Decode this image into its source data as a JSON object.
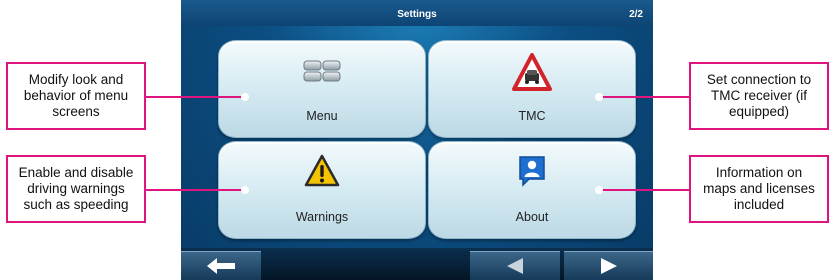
{
  "screen": {
    "title": "Settings",
    "page_indicator": "2/2"
  },
  "tiles": [
    {
      "label": "Menu",
      "icon": "menu-grid-icon"
    },
    {
      "label": "TMC",
      "icon": "tmc-traffic-warning-icon"
    },
    {
      "label": "Warnings",
      "icon": "warning-triangle-icon"
    },
    {
      "label": "About",
      "icon": "about-person-icon"
    }
  ],
  "callouts": {
    "menu": "Modify look and\nbehavior of menu\nscreens",
    "warnings": "Enable and disable\ndriving warnings\nsuch as speeding",
    "tmc": "Set connection to\nTMC receiver (if\nequipped)",
    "about": "Information on\nmaps and licenses\nincluded"
  },
  "nav": {
    "back_icon": "back-arrow-icon",
    "prev_icon": "previous-page-icon",
    "next_icon": "next-page-icon"
  },
  "colors": {
    "callout_border": "#e0147f",
    "screen_bg": "#0c4f83",
    "tile_bg": "#d8ecf3"
  }
}
